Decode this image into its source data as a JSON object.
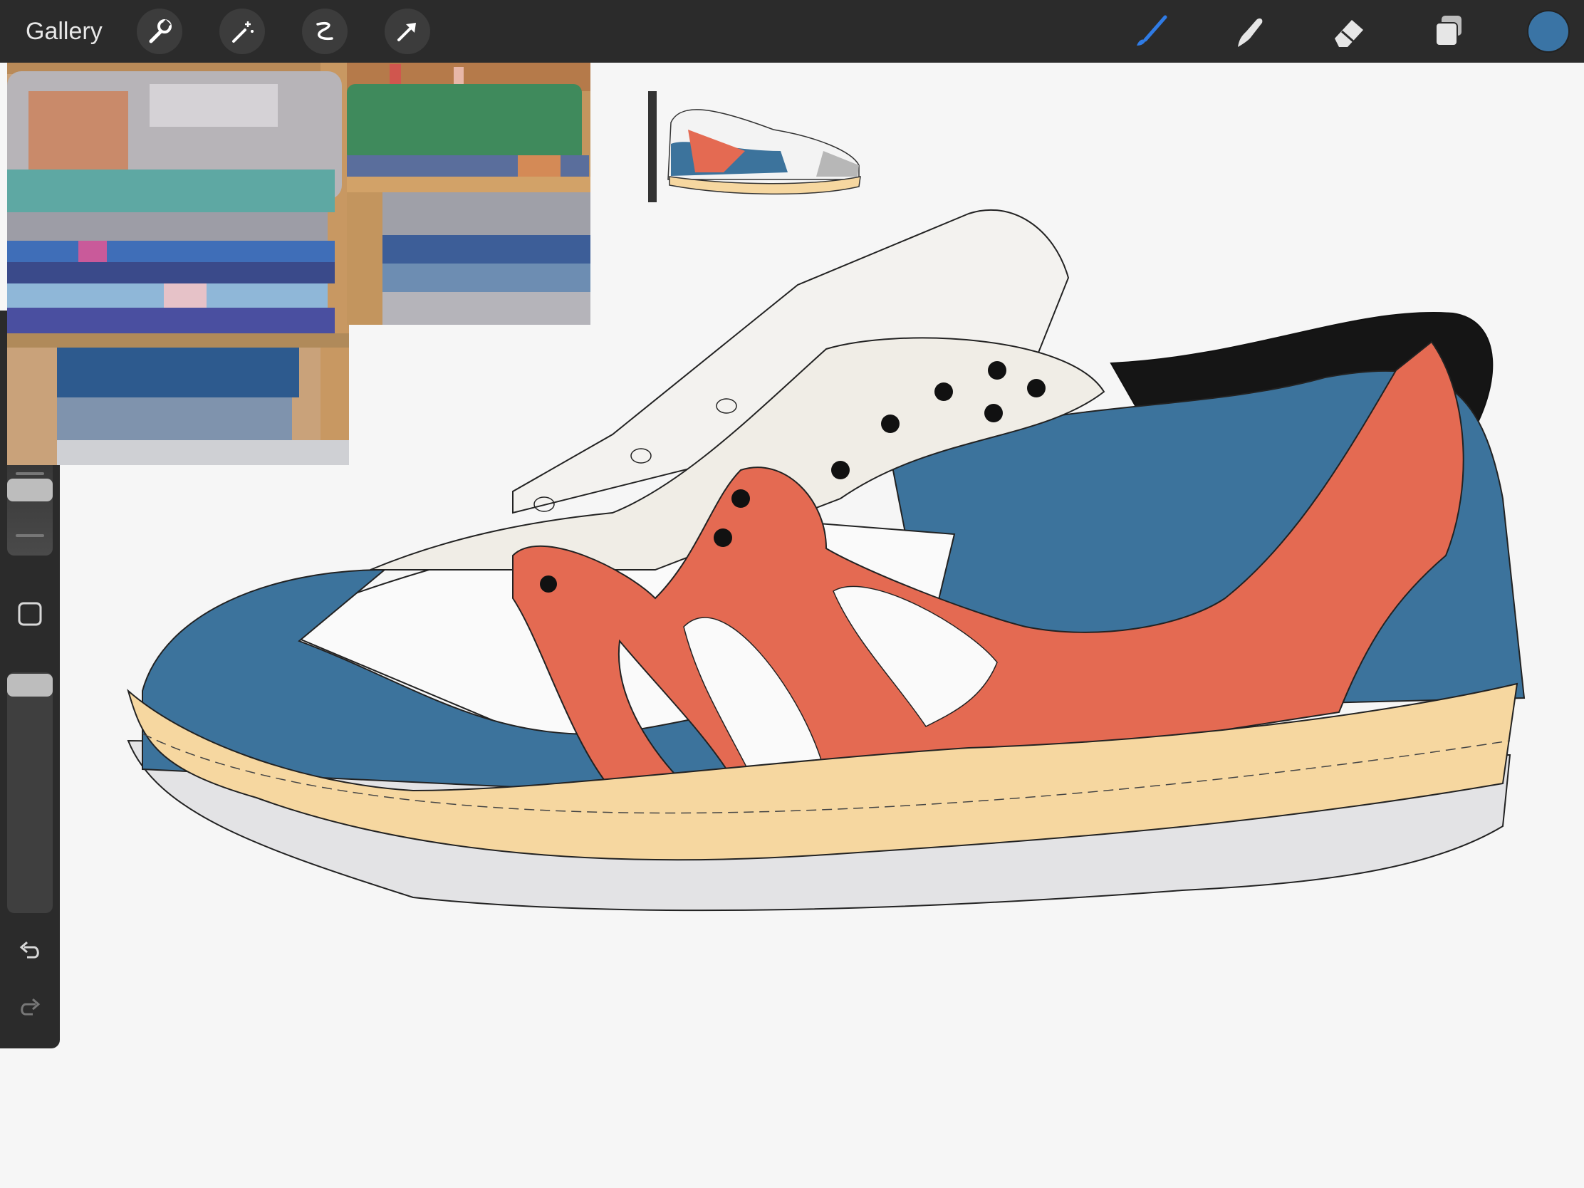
{
  "toolbar": {
    "gallery_label": "Gallery",
    "left_tools": [
      "wrench-icon",
      "magic-wand-icon",
      "selection-icon",
      "transform-arrow-icon"
    ],
    "right_tools": [
      "brush-icon",
      "smudge-icon",
      "eraser-icon",
      "layers-icon"
    ],
    "active_tool": "brush-icon",
    "current_color": "#3a74a5"
  },
  "sidebar": {
    "brush_size_level": 0.12,
    "opacity_level": 0.0,
    "buttons": [
      "modify-square-icon",
      "undo-icon",
      "redo-icon"
    ]
  },
  "canvas": {
    "references": [
      "folded-blankets-photo",
      "green-blanket-photo",
      "shoe-thumbnail"
    ],
    "palette": {
      "blue": "#3c739c",
      "orange": "#e46a52",
      "cream": "#f0ede6",
      "sole": "#f6d7a0",
      "outsole": "#e3e3e5",
      "collar": "#151515"
    }
  }
}
